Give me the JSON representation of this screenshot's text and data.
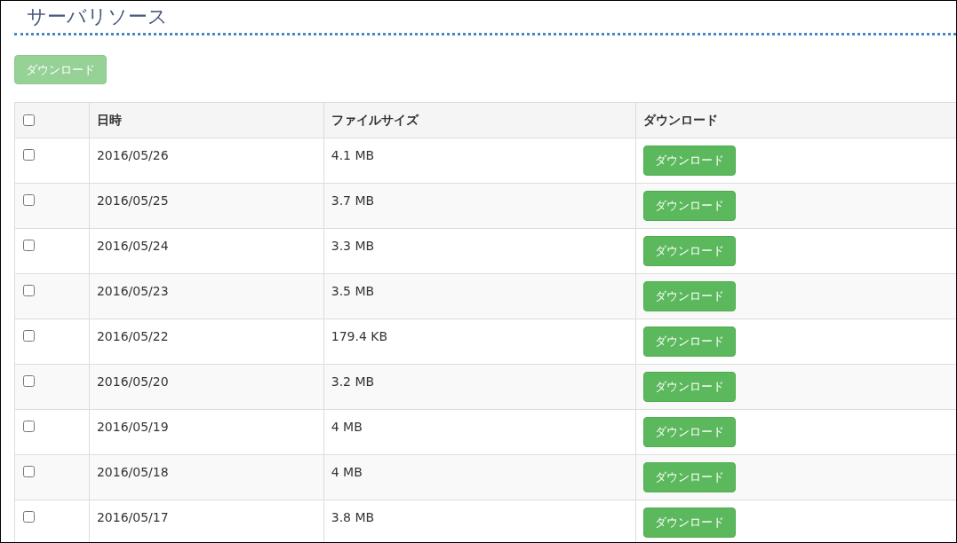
{
  "page_title": "サーバリソース",
  "toolbar": {
    "download_button": {
      "label": "ダウンロード",
      "disabled": true
    }
  },
  "table": {
    "columns": [
      {
        "kind": "checkbox",
        "checked": false
      },
      {
        "kind": "text",
        "label": "日時"
      },
      {
        "kind": "text",
        "label": "ファイルサイズ"
      },
      {
        "kind": "text",
        "label": "ダウンロード"
      }
    ],
    "rows": [
      {
        "checked": false,
        "date": "2016/05/26",
        "size": "4.1 MB",
        "button": "ダウンロード"
      },
      {
        "checked": false,
        "date": "2016/05/25",
        "size": "3.7 MB",
        "button": "ダウンロード"
      },
      {
        "checked": false,
        "date": "2016/05/24",
        "size": "3.3 MB",
        "button": "ダウンロード"
      },
      {
        "checked": false,
        "date": "2016/05/23",
        "size": "3.5 MB",
        "button": "ダウンロード"
      },
      {
        "checked": false,
        "date": "2016/05/22",
        "size": "179.4 KB",
        "button": "ダウンロード"
      },
      {
        "checked": false,
        "date": "2016/05/20",
        "size": "3.2 MB",
        "button": "ダウンロード"
      },
      {
        "checked": false,
        "date": "2016/05/19",
        "size": "4 MB",
        "button": "ダウンロード"
      },
      {
        "checked": false,
        "date": "2016/05/18",
        "size": "4 MB",
        "button": "ダウンロード"
      },
      {
        "checked": false,
        "date": "2016/05/17",
        "size": "3.8 MB",
        "button": "ダウンロード"
      }
    ]
  }
}
